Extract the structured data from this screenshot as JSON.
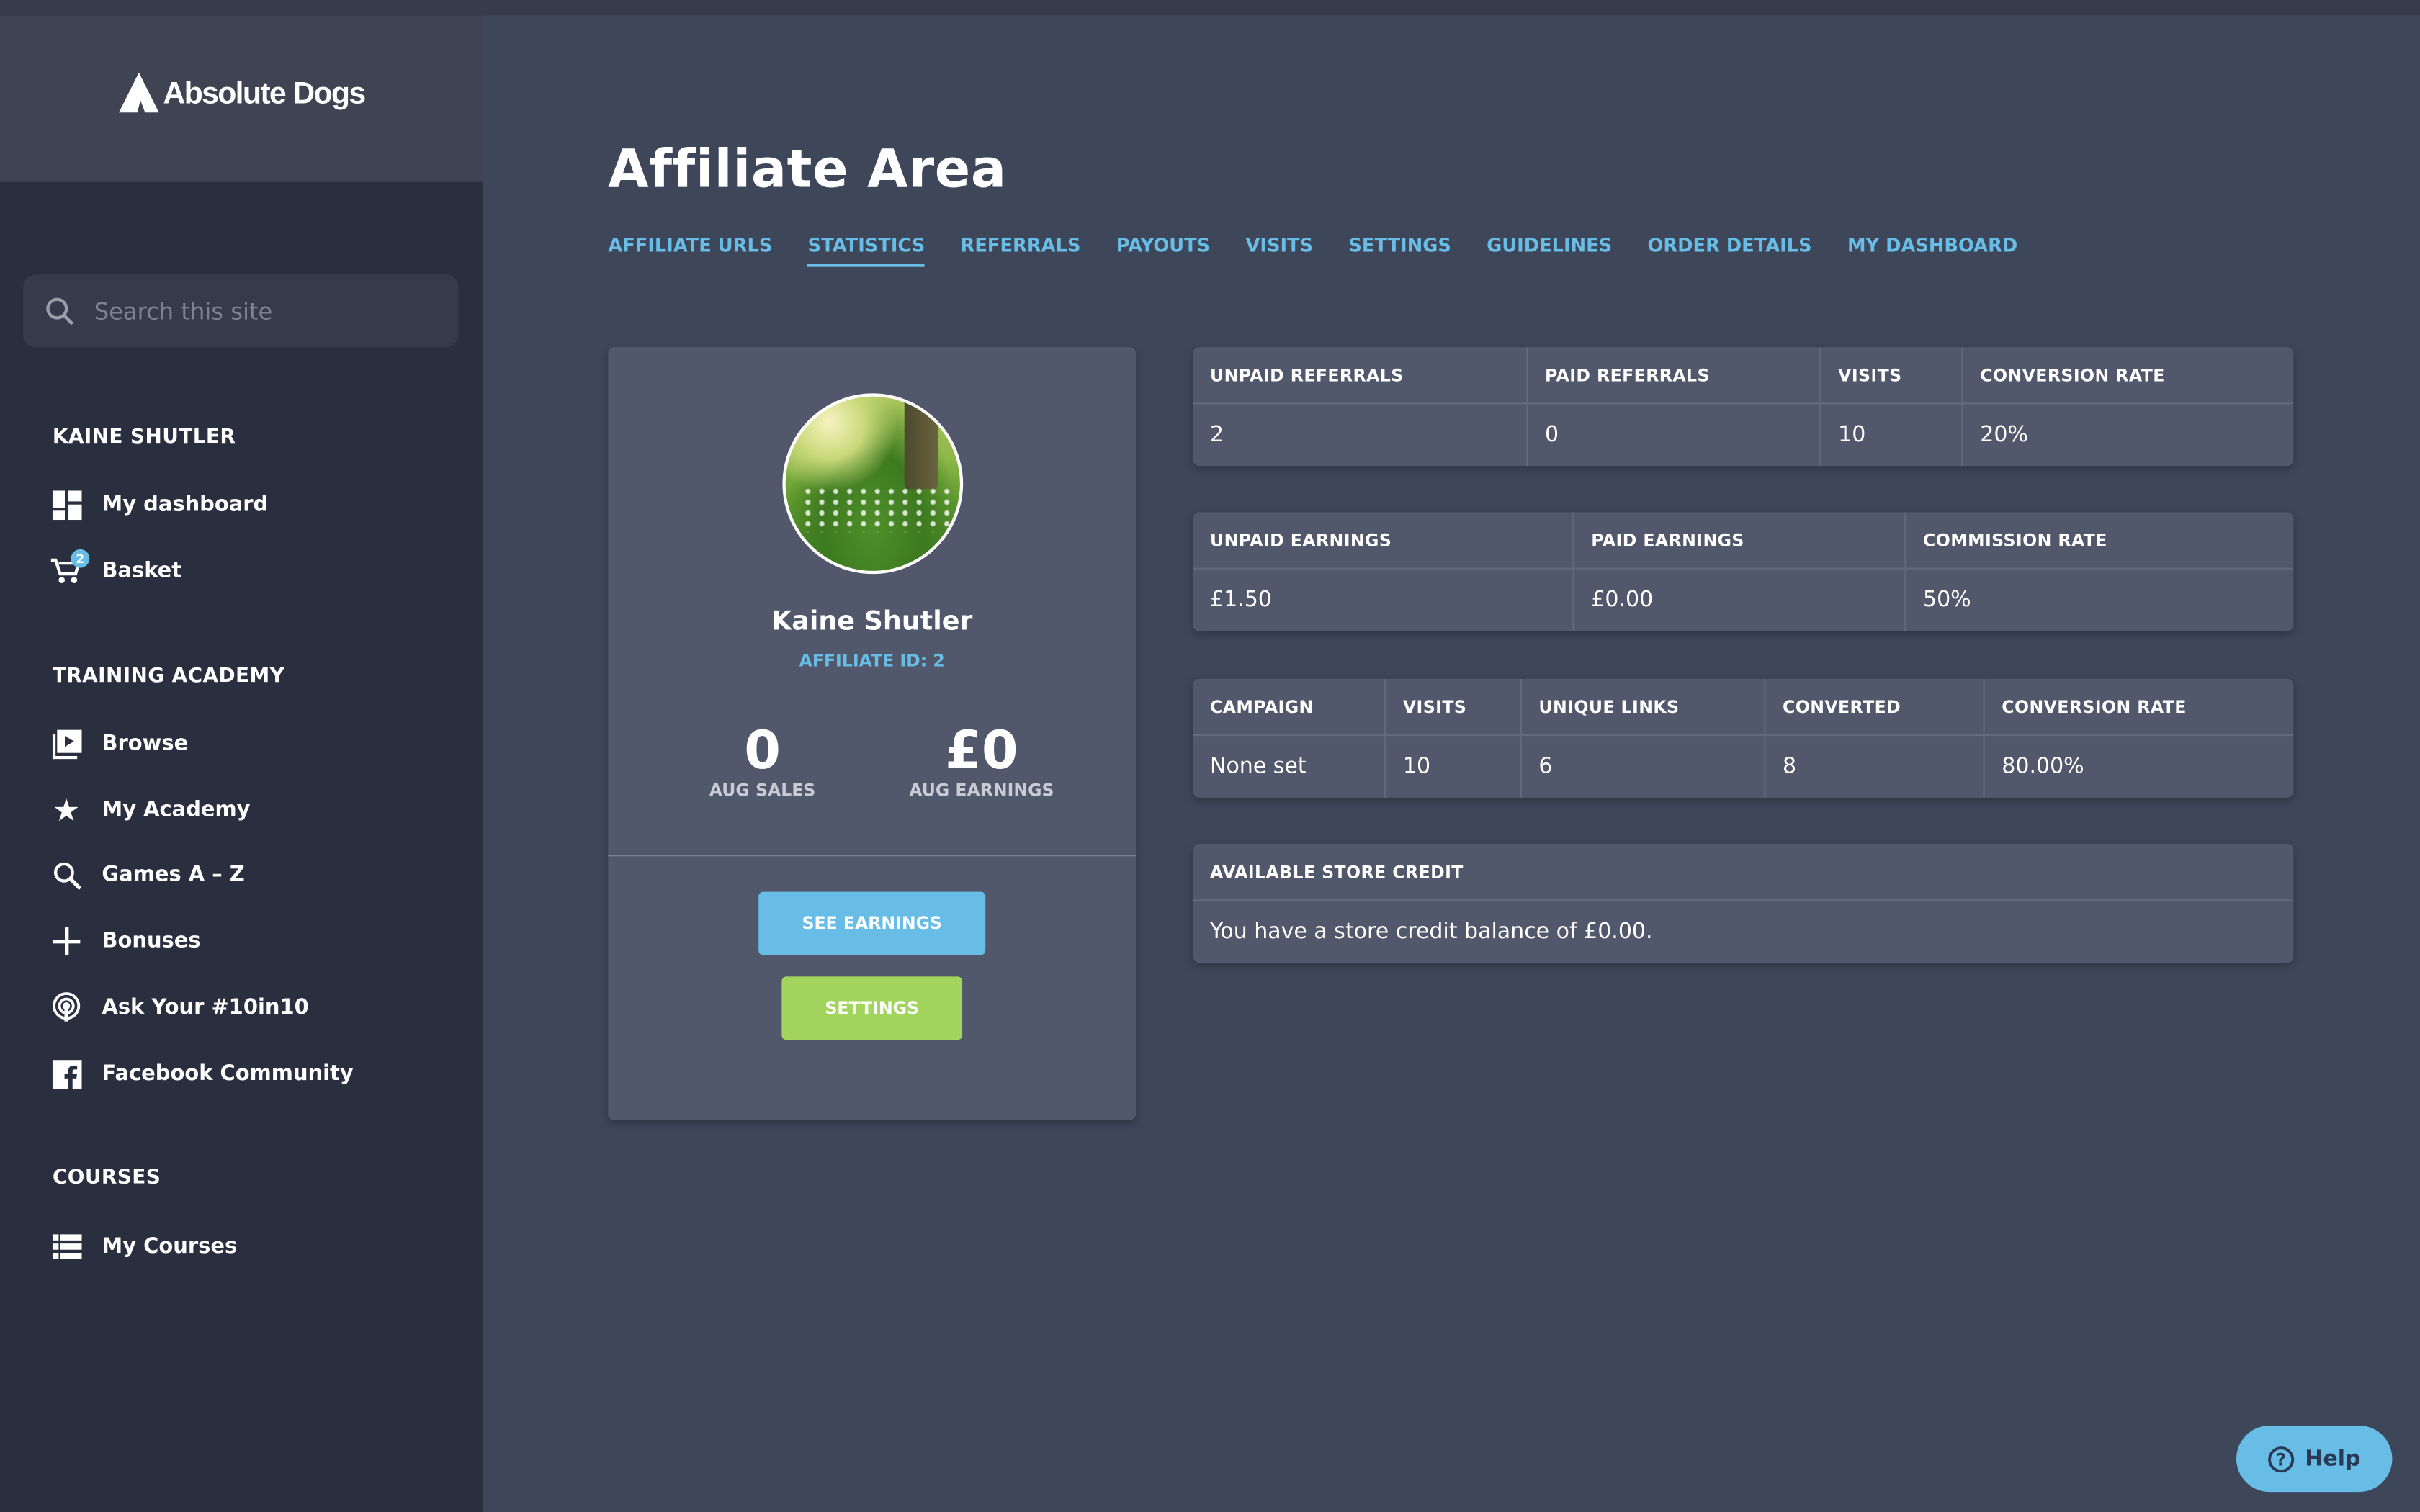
{
  "brand": {
    "name": "Absolute Dogs",
    "accent": "#68bde6",
    "green": "#a2d45e"
  },
  "search": {
    "placeholder": "Search this site"
  },
  "sidebar": {
    "sections": [
      {
        "title": "KAINE SHUTLER",
        "items": [
          {
            "label": "My dashboard",
            "icon": "dashboard-icon"
          },
          {
            "label": "Basket",
            "icon": "cart-icon",
            "badge": "2"
          }
        ]
      },
      {
        "title": "TRAINING ACADEMY",
        "items": [
          {
            "label": "Browse",
            "icon": "play-icon"
          },
          {
            "label": "My Academy",
            "icon": "star-icon"
          },
          {
            "label": "Games A – Z",
            "icon": "search-icon"
          },
          {
            "label": "Bonuses",
            "icon": "plus-icon"
          },
          {
            "label": "Ask Your #10in10",
            "icon": "podcast-icon"
          },
          {
            "label": "Facebook Community",
            "icon": "facebook-icon"
          }
        ]
      },
      {
        "title": "COURSES",
        "items": [
          {
            "label": "My Courses",
            "icon": "list-icon"
          }
        ]
      }
    ]
  },
  "page": {
    "title": "Affiliate Area"
  },
  "tabs": [
    "AFFILIATE URLS",
    "STATISTICS",
    "REFERRALS",
    "PAYOUTS",
    "VISITS",
    "SETTINGS",
    "GUIDELINES",
    "ORDER DETAILS",
    "MY DASHBOARD"
  ],
  "active_tab": "STATISTICS",
  "profile": {
    "name": "Kaine Shutler",
    "affiliate_id": "AFFILIATE ID: 2",
    "sales_value": "0",
    "sales_label": "AUG SALES",
    "earnings_value": "£0",
    "earnings_label": "AUG EARNINGS",
    "see_earnings": "SEE EARNINGS",
    "settings": "SETTINGS"
  },
  "tables": [
    {
      "headers": [
        "UNPAID REFERRALS",
        "PAID REFERRALS",
        "VISITS",
        "CONVERSION RATE"
      ],
      "values": [
        "2",
        "0",
        "10",
        "20%"
      ]
    },
    {
      "headers": [
        "UNPAID EARNINGS",
        "PAID EARNINGS",
        "COMMISSION RATE"
      ],
      "values": [
        "£1.50",
        "£0.00",
        "50%"
      ]
    },
    {
      "headers": [
        "CAMPAIGN",
        "VISITS",
        "UNIQUE LINKS",
        "CONVERTED",
        "CONVERSION RATE"
      ],
      "values": [
        "None set",
        "10",
        "6",
        "8",
        "80.00%"
      ]
    },
    {
      "headers": [
        "AVAILABLE STORE CREDIT"
      ],
      "values": [
        "You have a store credit balance of £0.00."
      ]
    }
  ],
  "help": {
    "label": "Help"
  }
}
